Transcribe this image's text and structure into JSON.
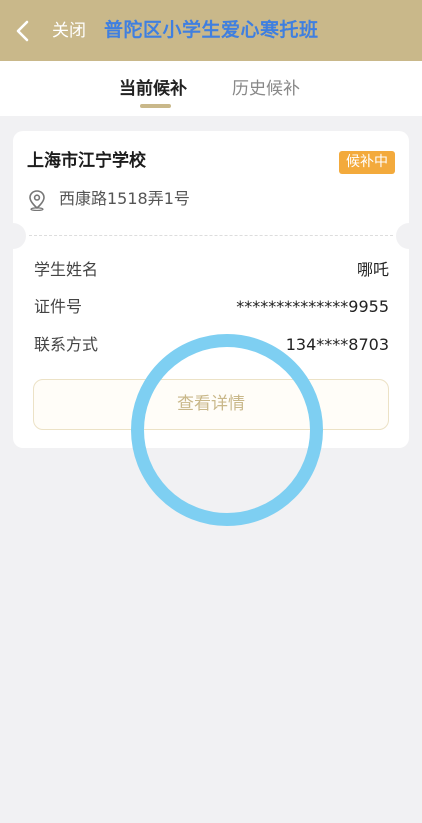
{
  "header": {
    "close_label": "关闭",
    "title": "普陀区小学生爱心寒托班",
    "back_icon": "chevron-left-icon",
    "background_color": "#c9b88a",
    "title_color": "#3f7fe0"
  },
  "tabs": [
    {
      "label": "当前候补",
      "active": true
    },
    {
      "label": "历史候补",
      "active": false
    }
  ],
  "card": {
    "school_name": "上海市江宁学校",
    "status": "候补中",
    "status_color": "#f3aa3c",
    "location_icon": "location-pin-icon",
    "address": "西康路1518弄1号",
    "rows": [
      {
        "label": "学生姓名",
        "value": "哪吒"
      },
      {
        "label": "证件号",
        "value": "**************9955"
      },
      {
        "label": "联系方式",
        "value": "134****8703"
      }
    ],
    "detail_button_label": "查看详情"
  }
}
